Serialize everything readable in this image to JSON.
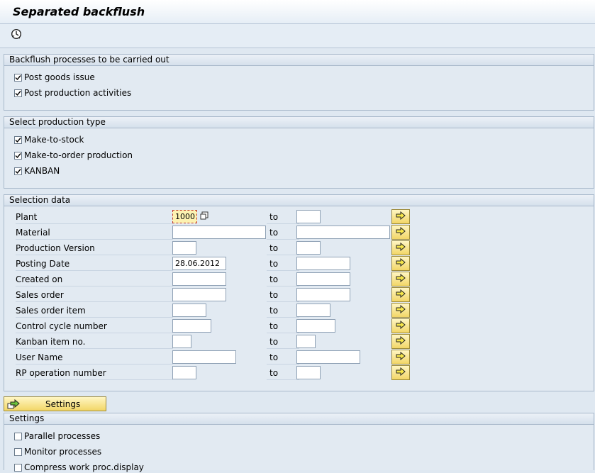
{
  "title": "Separated backflush",
  "groups": {
    "processes": {
      "header": "Backflush processes to be carried out",
      "items": [
        {
          "label": "Post goods issue",
          "checked": true
        },
        {
          "label": "Post production activities",
          "checked": true
        }
      ]
    },
    "production_type": {
      "header": "Select production type",
      "items": [
        {
          "label": "Make-to-stock",
          "checked": true
        },
        {
          "label": "Make-to-order production",
          "checked": true
        },
        {
          "label": "KANBAN",
          "checked": true
        }
      ]
    },
    "selection": {
      "header": "Selection data",
      "to_label": "to",
      "rows": [
        {
          "label": "Plant",
          "from": "1000",
          "to": ""
        },
        {
          "label": "Material",
          "from": "",
          "to": ""
        },
        {
          "label": "Production Version",
          "from": "",
          "to": ""
        },
        {
          "label": "Posting Date",
          "from": "28.06.2012",
          "to": ""
        },
        {
          "label": "Created on",
          "from": "",
          "to": ""
        },
        {
          "label": "Sales order",
          "from": "",
          "to": ""
        },
        {
          "label": "Sales order item",
          "from": "",
          "to": ""
        },
        {
          "label": "Control cycle number",
          "from": "",
          "to": ""
        },
        {
          "label": "Kanban item no.",
          "from": "",
          "to": ""
        },
        {
          "label": "User Name",
          "from": "",
          "to": ""
        },
        {
          "label": "RP operation number",
          "from": "",
          "to": ""
        }
      ]
    },
    "settings": {
      "button_label": "Settings",
      "header": "Settings",
      "items": [
        {
          "label": "Parallel processes",
          "checked": false
        },
        {
          "label": "Monitor processes",
          "checked": false
        },
        {
          "label": "Compress work proc.display",
          "checked": false
        }
      ]
    }
  },
  "icons": {
    "execute": "execute-clock-icon",
    "multiple_selection": "multiple-selection-arrow-icon",
    "matchcode": "matchcode-icon",
    "settings": "settings-arrow-icon"
  },
  "colors": {
    "button_yellow": "#f2d667",
    "required_field": "#fdf2b1",
    "background": "#dfe8f1"
  }
}
